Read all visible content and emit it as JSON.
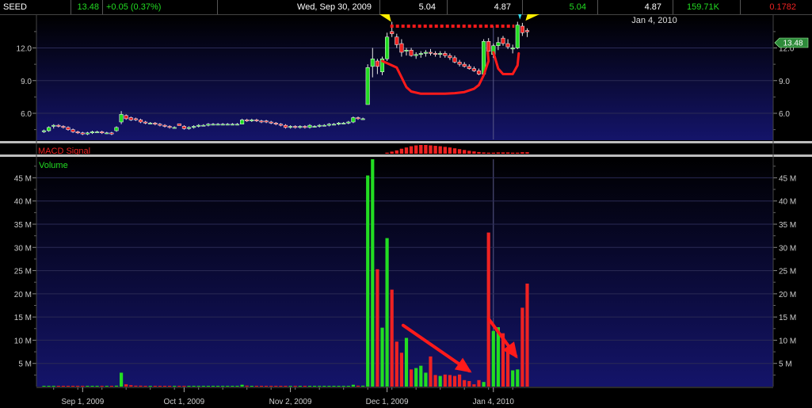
{
  "header": {
    "symbol": "SEED",
    "last": "13.48",
    "change": "+0.05 (0.37%)",
    "date": "Wed, Sep 30, 2009",
    "open": "5.04",
    "high": "4.87",
    "low": "5.04",
    "close": "4.87",
    "volume": "159.71K",
    "extra": "0.1782"
  },
  "colors": {
    "up": "#22dd22",
    "down": "#ee2222",
    "annotation_red": "#ff1a1a",
    "arrow_yellow": "#ffee00",
    "arrow_cyan": "#33ddee",
    "background_top": "#14146a",
    "grid": "#2a2a55"
  },
  "chart_data": [
    {
      "type": "candlestick",
      "title": "",
      "date_label": "Jan 4, 2010",
      "last_price_badge": "13.48",
      "y_ticks": [
        "6.0",
        "9.0",
        "12.0"
      ],
      "ylim": [
        3.6,
        14.8
      ],
      "x_ticks": [
        "Sep 1, 2009",
        "Oct 1, 2009",
        "Nov 2, 2009",
        "Dec 1, 2009",
        "Jan 4, 2010"
      ],
      "candles": [
        {
          "d": "Aug 20",
          "o": 4.3,
          "h": 4.5,
          "l": 4.2,
          "c": 4.4
        },
        {
          "d": "Aug 21",
          "o": 4.4,
          "h": 4.8,
          "l": 4.3,
          "c": 4.7
        },
        {
          "d": "Aug 24",
          "o": 4.8,
          "h": 5.0,
          "l": 4.6,
          "c": 4.9
        },
        {
          "d": "Aug 25",
          "o": 4.9,
          "h": 5.0,
          "l": 4.7,
          "c": 4.8
        },
        {
          "d": "Aug 26",
          "o": 4.8,
          "h": 4.9,
          "l": 4.6,
          "c": 4.7
        },
        {
          "d": "Aug 27",
          "o": 4.7,
          "h": 4.8,
          "l": 4.4,
          "c": 4.5
        },
        {
          "d": "Aug 28",
          "o": 4.5,
          "h": 4.6,
          "l": 4.2,
          "c": 4.3
        },
        {
          "d": "Aug 31",
          "o": 4.3,
          "h": 4.4,
          "l": 4.1,
          "c": 4.2
        },
        {
          "d": "Sep 1",
          "o": 4.2,
          "h": 4.3,
          "l": 4.0,
          "c": 4.1
        },
        {
          "d": "Sep 2",
          "o": 4.1,
          "h": 4.3,
          "l": 4.0,
          "c": 4.2
        },
        {
          "d": "Sep 3",
          "o": 4.2,
          "h": 4.4,
          "l": 4.1,
          "c": 4.3
        },
        {
          "d": "Sep 4",
          "o": 4.3,
          "h": 4.4,
          "l": 4.2,
          "c": 4.3
        },
        {
          "d": "Sep 8",
          "o": 4.3,
          "h": 4.4,
          "l": 4.1,
          "c": 4.2
        },
        {
          "d": "Sep 9",
          "o": 4.2,
          "h": 4.3,
          "l": 4.1,
          "c": 4.2
        },
        {
          "d": "Sep 10",
          "o": 4.2,
          "h": 4.3,
          "l": 4.0,
          "c": 4.1
        },
        {
          "d": "Sep 11",
          "o": 4.4,
          "h": 4.8,
          "l": 4.3,
          "c": 4.7
        },
        {
          "d": "Sep 14",
          "o": 5.2,
          "h": 6.2,
          "l": 5.0,
          "c": 5.9
        },
        {
          "d": "Sep 15",
          "o": 5.8,
          "h": 5.9,
          "l": 5.4,
          "c": 5.5
        },
        {
          "d": "Sep 16",
          "o": 5.6,
          "h": 5.7,
          "l": 5.3,
          "c": 5.4
        },
        {
          "d": "Sep 17",
          "o": 5.5,
          "h": 5.6,
          "l": 5.3,
          "c": 5.4
        },
        {
          "d": "Sep 18",
          "o": 5.4,
          "h": 5.5,
          "l": 5.1,
          "c": 5.2
        },
        {
          "d": "Sep 21",
          "o": 5.2,
          "h": 5.3,
          "l": 5.0,
          "c": 5.1
        },
        {
          "d": "Sep 22",
          "o": 5.1,
          "h": 5.2,
          "l": 5.0,
          "c": 5.1
        },
        {
          "d": "Sep 23",
          "o": 5.1,
          "h": 5.2,
          "l": 4.9,
          "c": 5.0
        },
        {
          "d": "Sep 24",
          "o": 5.0,
          "h": 5.1,
          "l": 4.8,
          "c": 4.9
        },
        {
          "d": "Sep 25",
          "o": 4.9,
          "h": 5.0,
          "l": 4.7,
          "c": 4.8
        },
        {
          "d": "Sep 28",
          "o": 4.8,
          "h": 4.9,
          "l": 4.6,
          "c": 4.7
        },
        {
          "d": "Sep 29",
          "o": 4.7,
          "h": 4.8,
          "l": 4.6,
          "c": 4.7
        },
        {
          "d": "Sep 30",
          "o": 5.04,
          "h": 5.04,
          "l": 4.87,
          "c": 4.87
        },
        {
          "d": "Oct 1",
          "o": 4.8,
          "h": 4.9,
          "l": 4.5,
          "c": 4.6
        },
        {
          "d": "Oct 2",
          "o": 4.6,
          "h": 4.8,
          "l": 4.5,
          "c": 4.7
        },
        {
          "d": "Oct 5",
          "o": 4.7,
          "h": 4.9,
          "l": 4.6,
          "c": 4.8
        },
        {
          "d": "Oct 6",
          "o": 4.8,
          "h": 5.0,
          "l": 4.7,
          "c": 4.9
        },
        {
          "d": "Oct 7",
          "o": 4.9,
          "h": 5.0,
          "l": 4.8,
          "c": 4.9
        },
        {
          "d": "Oct 8",
          "o": 4.9,
          "h": 5.1,
          "l": 4.8,
          "c": 5.0
        },
        {
          "d": "Oct 9",
          "o": 5.0,
          "h": 5.1,
          "l": 4.9,
          "c": 5.0
        },
        {
          "d": "Oct 12",
          "o": 5.0,
          "h": 5.1,
          "l": 4.9,
          "c": 5.0
        },
        {
          "d": "Oct 13",
          "o": 5.0,
          "h": 5.1,
          "l": 4.9,
          "c": 5.0
        },
        {
          "d": "Oct 14",
          "o": 5.0,
          "h": 5.1,
          "l": 4.9,
          "c": 5.0
        },
        {
          "d": "Oct 15",
          "o": 5.0,
          "h": 5.1,
          "l": 4.9,
          "c": 5.0
        },
        {
          "d": "Oct 16",
          "o": 5.0,
          "h": 5.1,
          "l": 4.9,
          "c": 5.0
        },
        {
          "d": "Oct 19",
          "o": 5.0,
          "h": 5.5,
          "l": 5.0,
          "c": 5.4
        },
        {
          "d": "Oct 20",
          "o": 5.4,
          "h": 5.5,
          "l": 5.2,
          "c": 5.3
        },
        {
          "d": "Oct 21",
          "o": 5.3,
          "h": 5.5,
          "l": 5.2,
          "c": 5.4
        },
        {
          "d": "Oct 22",
          "o": 5.4,
          "h": 5.5,
          "l": 5.2,
          "c": 5.3
        },
        {
          "d": "Oct 23",
          "o": 5.3,
          "h": 5.4,
          "l": 5.1,
          "c": 5.2
        },
        {
          "d": "Oct 26",
          "o": 5.3,
          "h": 5.4,
          "l": 5.1,
          "c": 5.2
        },
        {
          "d": "Oct 27",
          "o": 5.2,
          "h": 5.3,
          "l": 5.0,
          "c": 5.1
        },
        {
          "d": "Oct 28",
          "o": 5.1,
          "h": 5.2,
          "l": 4.9,
          "c": 5.0
        },
        {
          "d": "Oct 29",
          "o": 5.0,
          "h": 5.1,
          "l": 4.8,
          "c": 4.9
        },
        {
          "d": "Oct 30",
          "o": 4.9,
          "h": 5.0,
          "l": 4.6,
          "c": 4.7
        },
        {
          "d": "Nov 2",
          "o": 4.7,
          "h": 4.9,
          "l": 4.6,
          "c": 4.8
        },
        {
          "d": "Nov 3",
          "o": 4.8,
          "h": 4.9,
          "l": 4.6,
          "c": 4.7
        },
        {
          "d": "Nov 4",
          "o": 4.7,
          "h": 4.9,
          "l": 4.6,
          "c": 4.8
        },
        {
          "d": "Nov 5",
          "o": 4.8,
          "h": 4.9,
          "l": 4.6,
          "c": 4.7
        },
        {
          "d": "Nov 6",
          "o": 4.7,
          "h": 5.0,
          "l": 4.6,
          "c": 4.9
        },
        {
          "d": "Nov 9",
          "o": 4.8,
          "h": 4.9,
          "l": 4.7,
          "c": 4.8
        },
        {
          "d": "Nov 10",
          "o": 4.8,
          "h": 5.0,
          "l": 4.7,
          "c": 4.9
        },
        {
          "d": "Nov 11",
          "o": 4.9,
          "h": 5.0,
          "l": 4.8,
          "c": 4.9
        },
        {
          "d": "Nov 12",
          "o": 4.9,
          "h": 5.1,
          "l": 4.8,
          "c": 5.0
        },
        {
          "d": "Nov 13",
          "o": 5.0,
          "h": 5.1,
          "l": 4.9,
          "c": 5.0
        },
        {
          "d": "Nov 16",
          "o": 5.0,
          "h": 5.2,
          "l": 4.9,
          "c": 5.1
        },
        {
          "d": "Nov 17",
          "o": 5.1,
          "h": 5.2,
          "l": 5.0,
          "c": 5.1
        },
        {
          "d": "Nov 18",
          "o": 5.1,
          "h": 5.3,
          "l": 5.0,
          "c": 5.2
        },
        {
          "d": "Nov 19",
          "o": 5.2,
          "h": 5.7,
          "l": 5.1,
          "c": 5.6
        },
        {
          "d": "Nov 20",
          "o": 5.6,
          "h": 5.7,
          "l": 5.4,
          "c": 5.5
        },
        {
          "d": "Nov 23",
          "o": 5.5,
          "h": 5.6,
          "l": 5.4,
          "c": 5.5
        },
        {
          "d": "Nov 24",
          "o": 6.8,
          "h": 10.5,
          "l": 6.8,
          "c": 10.2
        },
        {
          "d": "Nov 25",
          "o": 10.3,
          "h": 12.0,
          "l": 9.3,
          "c": 11.0
        },
        {
          "d": "Nov 27",
          "o": 10.8,
          "h": 11.0,
          "l": 9.6,
          "c": 10.3
        },
        {
          "d": "Nov 30",
          "o": 9.8,
          "h": 11.2,
          "l": 9.5,
          "c": 11.0
        },
        {
          "d": "Dec 1",
          "o": 11.0,
          "h": 13.4,
          "l": 10.8,
          "c": 13.0
        },
        {
          "d": "Dec 2",
          "o": 13.5,
          "h": 14.4,
          "l": 13.0,
          "c": 13.3
        },
        {
          "d": "Dec 3",
          "o": 13.0,
          "h": 13.3,
          "l": 12.0,
          "c": 12.3
        },
        {
          "d": "Dec 4",
          "o": 12.4,
          "h": 12.8,
          "l": 11.2,
          "c": 11.6
        },
        {
          "d": "Dec 7",
          "o": 11.7,
          "h": 12.0,
          "l": 11.3,
          "c": 11.8
        },
        {
          "d": "Dec 8",
          "o": 11.8,
          "h": 12.0,
          "l": 11.2,
          "c": 11.3
        },
        {
          "d": "Dec 9",
          "o": 11.3,
          "h": 11.6,
          "l": 11.0,
          "c": 11.4
        },
        {
          "d": "Dec 10",
          "o": 11.4,
          "h": 11.7,
          "l": 11.1,
          "c": 11.5
        },
        {
          "d": "Dec 11",
          "o": 11.5,
          "h": 11.8,
          "l": 11.2,
          "c": 11.6
        },
        {
          "d": "Dec 14",
          "o": 11.6,
          "h": 11.9,
          "l": 11.3,
          "c": 11.5
        },
        {
          "d": "Dec 15",
          "o": 11.5,
          "h": 11.7,
          "l": 11.2,
          "c": 11.4
        },
        {
          "d": "Dec 16",
          "o": 11.4,
          "h": 11.7,
          "l": 11.1,
          "c": 11.5
        },
        {
          "d": "Dec 17",
          "o": 11.5,
          "h": 11.7,
          "l": 11.1,
          "c": 11.3
        },
        {
          "d": "Dec 18",
          "o": 11.3,
          "h": 11.5,
          "l": 10.9,
          "c": 11.1
        },
        {
          "d": "Dec 21",
          "o": 11.1,
          "h": 11.3,
          "l": 10.6,
          "c": 10.7
        },
        {
          "d": "Dec 22",
          "o": 10.7,
          "h": 10.9,
          "l": 10.3,
          "c": 10.5
        },
        {
          "d": "Dec 23",
          "o": 10.5,
          "h": 10.7,
          "l": 10.2,
          "c": 10.3
        },
        {
          "d": "Dec 24",
          "o": 10.3,
          "h": 10.5,
          "l": 10.0,
          "c": 10.1
        },
        {
          "d": "Dec 28",
          "o": 10.1,
          "h": 10.3,
          "l": 9.8,
          "c": 9.9
        },
        {
          "d": "Dec 29",
          "o": 9.9,
          "h": 10.1,
          "l": 9.5,
          "c": 9.6
        },
        {
          "d": "Dec 30",
          "o": 9.6,
          "h": 12.8,
          "l": 9.5,
          "c": 12.6
        },
        {
          "d": "Dec 31",
          "o": 12.6,
          "h": 12.9,
          "l": 11.4,
          "c": 11.7
        },
        {
          "d": "Jan 4",
          "o": 11.4,
          "h": 12.4,
          "l": 11.1,
          "c": 12.2
        },
        {
          "d": "Jan 5",
          "o": 12.2,
          "h": 13.0,
          "l": 11.8,
          "c": 12.5
        },
        {
          "d": "Jan 6",
          "o": 12.9,
          "h": 13.1,
          "l": 12.2,
          "c": 12.4
        },
        {
          "d": "Jan 7",
          "o": 12.4,
          "h": 12.8,
          "l": 11.9,
          "c": 12.1
        },
        {
          "d": "Jan 8",
          "o": 11.9,
          "h": 12.3,
          "l": 11.5,
          "c": 12.0
        },
        {
          "d": "Jan 11",
          "o": 12.0,
          "h": 14.4,
          "l": 11.9,
          "c": 14.1
        },
        {
          "d": "Jan 12",
          "o": 14.0,
          "h": 14.3,
          "l": 13.1,
          "c": 13.4
        },
        {
          "d": "Jan 13",
          "o": 13.6,
          "h": 13.8,
          "l": 13.0,
          "c": 13.48
        }
      ]
    },
    {
      "type": "bar",
      "title": "MACD Signal",
      "categories_from": "candles",
      "values_start_index": 71,
      "values": [
        0.05,
        0.1,
        0.16,
        0.24,
        0.3,
        0.36,
        0.4,
        0.42,
        0.42,
        0.4,
        0.38,
        0.36,
        0.33,
        0.3,
        0.26,
        0.22,
        0.18,
        0.14,
        0.11,
        0.08,
        0.06,
        0.05,
        0.05,
        0.06,
        0.06,
        0.06,
        0.05,
        0.05,
        0.07,
        0.07
      ]
    },
    {
      "type": "bar",
      "title": "Volume",
      "ylabel_ticks": [
        "5 M",
        "10 M",
        "15 M",
        "20 M",
        "25 M",
        "30 M",
        "35 M",
        "40 M",
        "45 M"
      ],
      "ylim": [
        0,
        49
      ],
      "unit": "M",
      "values": [
        0.1,
        0.1,
        0.1,
        0.1,
        0.1,
        0.1,
        0.1,
        0.1,
        0.1,
        0.1,
        0.1,
        0.1,
        0.1,
        0.1,
        0.1,
        0.2,
        3.0,
        0.5,
        0.3,
        0.2,
        0.2,
        0.1,
        0.1,
        0.1,
        0.1,
        0.1,
        0.1,
        0.1,
        0.16,
        0.1,
        0.1,
        0.1,
        0.1,
        0.1,
        0.1,
        0.1,
        0.1,
        0.1,
        0.1,
        0.1,
        0.1,
        0.4,
        0.2,
        0.1,
        0.1,
        0.1,
        0.1,
        0.1,
        0.1,
        0.1,
        0.1,
        0.1,
        0.1,
        0.1,
        0.1,
        0.1,
        0.1,
        0.1,
        0.1,
        0.1,
        0.1,
        0.1,
        0.1,
        0.1,
        0.4,
        0.2,
        0.2,
        45.5,
        49.0,
        25.3,
        12.7,
        32.0,
        20.9,
        9.7,
        7.3,
        10.5,
        3.7,
        4.0,
        4.5,
        3.0,
        6.5,
        2.5,
        2.3,
        2.6,
        2.5,
        2.3,
        2.6,
        1.4,
        1.2,
        0.5,
        1.4,
        1.0,
        33.2,
        12.0,
        12.8,
        11.5,
        8.0,
        3.5,
        3.7,
        17.0,
        22.2,
        1.7
      ]
    }
  ],
  "annotations": {
    "volume_label": "Volume",
    "macd_label": "MACD Signal"
  }
}
